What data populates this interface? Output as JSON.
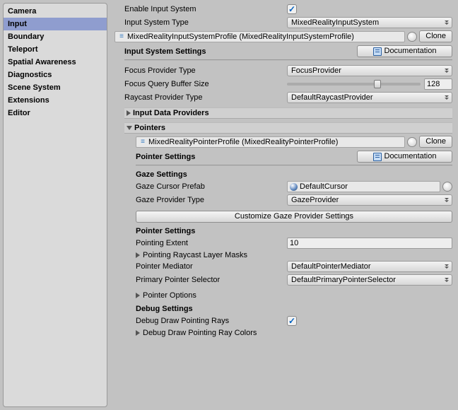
{
  "sidebar": {
    "items": [
      {
        "label": "Camera"
      },
      {
        "label": "Input"
      },
      {
        "label": "Boundary"
      },
      {
        "label": "Teleport"
      },
      {
        "label": "Spatial Awareness"
      },
      {
        "label": "Diagnostics"
      },
      {
        "label": "Scene System"
      },
      {
        "label": "Extensions"
      },
      {
        "label": "Editor"
      }
    ],
    "selected_index": 1
  },
  "main": {
    "enable_input_system_label": "Enable Input System",
    "enable_input_system_checked": true,
    "input_system_type_label": "Input System Type",
    "input_system_type_value": "MixedRealityInputSystem",
    "profile_name": "MixedRealityInputSystemProfile (MixedRealityInputSystemProfile)",
    "clone_label": "Clone",
    "input_system_settings_title": "Input System Settings",
    "documentation_label": "Documentation",
    "focus_provider_type_label": "Focus Provider Type",
    "focus_provider_type_value": "FocusProvider",
    "focus_query_buffer_label": "Focus Query Buffer Size",
    "focus_query_buffer_value": "128",
    "raycast_provider_type_label": "Raycast Provider Type",
    "raycast_provider_type_value": "DefaultRaycastProvider",
    "foldout_input_data_providers": "Input Data Providers",
    "foldout_pointers": "Pointers",
    "pointers": {
      "profile_name": "MixedRealityPointerProfile (MixedRealityPointerProfile)",
      "clone_label": "Clone",
      "pointer_settings_title": "Pointer Settings",
      "documentation_label": "Documentation",
      "gaze_settings_title": "Gaze Settings",
      "gaze_cursor_prefab_label": "Gaze Cursor Prefab",
      "gaze_cursor_prefab_value": "DefaultCursor",
      "gaze_provider_type_label": "Gaze Provider Type",
      "gaze_provider_type_value": "GazeProvider",
      "customize_gaze_btn": "Customize Gaze Provider Settings",
      "pointer_settings2_title": "Pointer Settings",
      "pointing_extent_label": "Pointing Extent",
      "pointing_extent_value": "10",
      "pointing_raycast_layer_masks_label": "Pointing Raycast Layer Masks",
      "pointer_mediator_label": "Pointer Mediator",
      "pointer_mediator_value": "DefaultPointerMediator",
      "primary_pointer_selector_label": "Primary Pointer Selector",
      "primary_pointer_selector_value": "DefaultPrimaryPointerSelector",
      "pointer_options_label": "Pointer Options",
      "debug_settings_title": "Debug Settings",
      "debug_draw_pointing_rays_label": "Debug Draw Pointing Rays",
      "debug_draw_pointing_rays_checked": true,
      "debug_draw_pointing_ray_colors_label": "Debug Draw Pointing Ray Colors"
    }
  }
}
